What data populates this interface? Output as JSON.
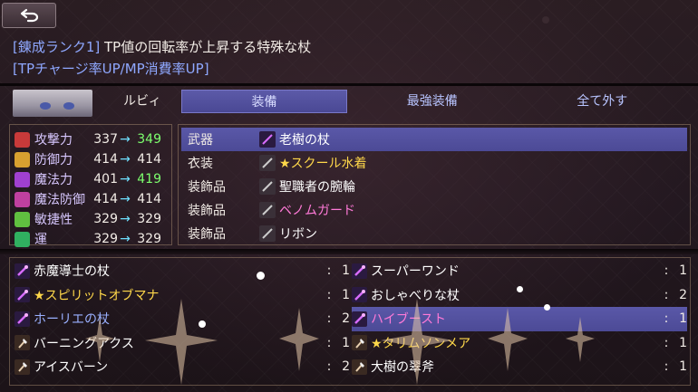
{
  "header": {
    "desc_line1_rank": "[錬成ランク1]",
    "desc_line1_text": " TP値の回転率が上昇する特殊な杖",
    "desc_line2": "[TPチャージ率UP/MP消費率UP]"
  },
  "character": {
    "name": "ルビィ"
  },
  "tabs": [
    "装備",
    "最強装備",
    "全て外す"
  ],
  "stats": [
    {
      "label": "攻撃力",
      "before": "337",
      "after": "349",
      "up": true,
      "icon": "sword-icon",
      "color": "#c83a3a"
    },
    {
      "label": "防御力",
      "before": "414",
      "after": "414",
      "up": false,
      "icon": "shield-icon",
      "color": "#d8a030"
    },
    {
      "label": "魔法力",
      "before": "401",
      "after": "419",
      "up": true,
      "icon": "magic-icon",
      "color": "#a040d0"
    },
    {
      "label": "魔法防御",
      "before": "414",
      "after": "414",
      "up": false,
      "icon": "magic-shield-icon",
      "color": "#c040a0"
    },
    {
      "label": "敏捷性",
      "before": "329",
      "after": "329",
      "up": false,
      "icon": "boot-icon",
      "color": "#60c040"
    },
    {
      "label": "運",
      "before": "329",
      "after": "329",
      "up": false,
      "icon": "clover-icon",
      "color": "#30b060"
    }
  ],
  "arrow": "→",
  "equipment": [
    {
      "slot": "武器",
      "item": "老樹の杖",
      "color": "#ffffff",
      "icon": "staff-icon"
    },
    {
      "slot": "衣装",
      "item": "★スクール水着",
      "color": "#ffd84a",
      "icon": "costume-icon"
    },
    {
      "slot": "装飾品",
      "item": "聖職者の腕輪",
      "color": "#ffffff",
      "icon": "bracelet-icon"
    },
    {
      "slot": "装飾品",
      "item": "ベノムガード",
      "color": "#ff7ad8",
      "icon": "guard-icon"
    },
    {
      "slot": "装飾品",
      "item": "リボン",
      "color": "#ffffff",
      "icon": "ribbon-icon"
    }
  ],
  "inventory_left": [
    {
      "name": "赤魔導士の杖",
      "count": "1",
      "color": "#ffffff",
      "icon": "staff-icon"
    },
    {
      "name": "★スピリットオブマナ",
      "count": "1",
      "color": "#ffd84a",
      "icon": "staff-icon"
    },
    {
      "name": "ホーリエの杖",
      "count": "2",
      "color": "#9ab0ff",
      "icon": "staff-icon"
    },
    {
      "name": "バーニングアクス",
      "count": "1",
      "color": "#ffffff",
      "icon": "axe-icon"
    },
    {
      "name": "アイスバーン",
      "count": "2",
      "color": "#ffffff",
      "icon": "axe-icon"
    }
  ],
  "inventory_right": [
    {
      "name": "スーパーワンド",
      "count": "1",
      "color": "#ffffff",
      "icon": "staff-icon"
    },
    {
      "name": "おしゃべりな杖",
      "count": "2",
      "color": "#ffffff",
      "icon": "staff-icon"
    },
    {
      "name": "ハイブースト",
      "count": "1",
      "color": "#ff7ad8",
      "icon": "staff-icon"
    },
    {
      "name": "★タリムソンメア",
      "count": "1",
      "color": "#ffd84a",
      "icon": "axe-icon"
    },
    {
      "name": "大樹の翠斧",
      "count": "1",
      "color": "#ffffff",
      "icon": "axe-icon"
    }
  ],
  "colon": ":"
}
